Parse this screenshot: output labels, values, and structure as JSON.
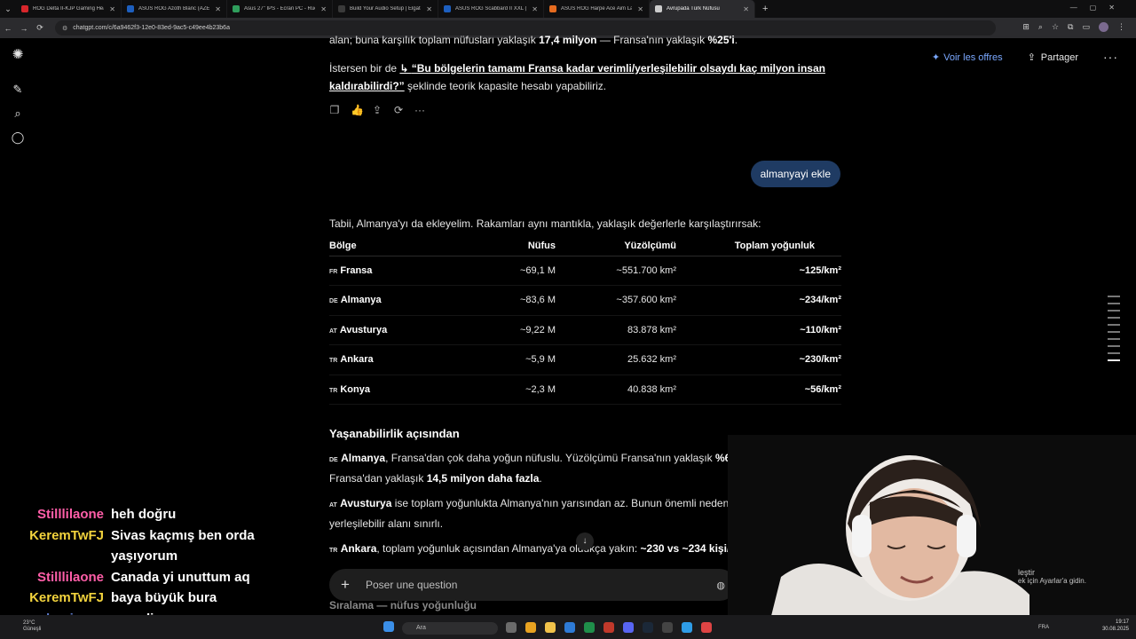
{
  "browser": {
    "tabs": [
      {
        "title": "ROG Delta II-KJP Gaming Headset",
        "color": "#d7262b"
      },
      {
        "title": "ASUS ROG Azoth Blanc (AZERTY)",
        "color": "#1d5fbf"
      },
      {
        "title": "Asus 27\" IPS - Ecran PC - Rue du Commerce",
        "color": "#2f9e5c"
      },
      {
        "title": "Build Your Audio Setup | Elgato",
        "color": "#3a3a3a"
      },
      {
        "title": "ASUS ROG Scabbard II XXL (Arm...",
        "color": "#1d5fbf"
      },
      {
        "title": "ASUS ROG Harpe Ace Aim Lab Edition",
        "color": "#e56b1f"
      },
      {
        "title": "Avrupada Türk Nüfusu",
        "color": "#cccccc"
      }
    ],
    "active_tab_index": 6,
    "url": "chatgpt.com/c/6a9462f3-12e0-83ed-9ac5-c49ee4b23b6a"
  },
  "header": {
    "offers_label": "Voir les offres",
    "share_label": "Partager"
  },
  "conversation": {
    "prev_line": "alan; buna karşılık toplam nüfusları yaklaşık 17,4 milyon — Fransa'nın yaklaşık %25'i.",
    "prev_line_parts": {
      "a": "alan; buna karşılık toplam nüfusları yaklaşık ",
      "b": "17,4 milyon",
      "c": " — Fransa'nın yaklaşık ",
      "d": "%25'i",
      "e": "."
    },
    "suggestion_prefix": "İstersen bir de ",
    "suggestion_arrow": "↳ ",
    "suggestion_link": "“Bu bölgelerin tamamı Fransa kadar verimli/yerleşilebilir olsaydı kaç milyon insan kaldırabilirdi?”",
    "suggestion_suffix": " şeklinde teorik kapasite hesabı yapabiliriz.",
    "user_message": "almanyayi ekle",
    "intro": "Tabii, Almanya'yı da ekleyelim. Rakamları aynı mantıkla, yaklaşık değerlerle karşılaştırırsak:",
    "table": {
      "headers": [
        "Bölge",
        "Nüfus",
        "Yüzölçümü",
        "Toplam yoğunluk"
      ],
      "rows": [
        {
          "flag": "FR",
          "name": "Fransa",
          "pop": "~69,1 M",
          "area": "~551.700 km²",
          "density": "~125/km²"
        },
        {
          "flag": "DE",
          "name": "Almanya",
          "pop": "~83,6 M",
          "area": "~357.600 km²",
          "density": "~234/km²"
        },
        {
          "flag": "AT",
          "name": "Avusturya",
          "pop": "~9,22 M",
          "area": "83.878 km²",
          "density": "~110/km²"
        },
        {
          "flag": "TR",
          "name": "Ankara",
          "pop": "~5,9 M",
          "area": "25.632 km²",
          "density": "~230/km²"
        },
        {
          "flag": "TR",
          "name": "Konya",
          "pop": "~2,3 M",
          "area": "40.838 km²",
          "density": "~56/km²"
        }
      ]
    },
    "section_title": "Yaşanabilirlik açısından",
    "para1": {
      "flag": "DE",
      "bold": "Almanya",
      "t1": ", Fransa'dan çok daha yoğun nüfuslu. Yüzölçümü Fransa'nın yaklaşık ",
      "b2": "%65'i",
      "t2": ", ama nüfusu Fransa'dan yaklaşık ",
      "b3": "14,5 milyon daha fazla",
      "t3": "."
    },
    "para2": {
      "flag": "AT",
      "bold": "Avusturya",
      "t1": " ise toplam yoğunlukta Almanya'nın yarısından az. Bunun önemli nedeni Alpler: ülkenin yerleşilebilir alanı sınırlı."
    },
    "para3": {
      "flag": "TR",
      "bold": "Ankara",
      "t1": ", toplam yoğunluk açısından Almanya'ya oldukça yakın: ",
      "b2": "~230 vs ~234 kişi/km²",
      "t2": "."
    },
    "trailing_text": "Sıralama — nüfus yoğunluğu"
  },
  "composer": {
    "placeholder": "Poser une question"
  },
  "stream_chat": [
    {
      "user": "Stilllilaone",
      "color": "#ff5ea8",
      "msg": "heh doğru"
    },
    {
      "user": "KeremTwFJ",
      "color": "#f2d33d",
      "msg": "Sivas kaçmış ben orda yaşıyorum"
    },
    {
      "user": "Stilllilaone",
      "color": "#ff5ea8",
      "msg": "Canada yi unuttum aq"
    },
    {
      "user": "KeremTwFJ",
      "color": "#f2d33d",
      "msg": "baya büyük bura"
    },
    {
      "user": "lumixeux",
      "color": "#5b79c9",
      "msg": "onemli"
    }
  ],
  "windows_toast": {
    "title": "leştir",
    "body": "ek için Ayarlar'a gidin."
  },
  "taskbar": {
    "weather_temp": "23°C",
    "weather_desc": "Güneşli",
    "search_placeholder": "Ara",
    "lang": "FRA",
    "time": "19:17",
    "date": "30.08.2025"
  }
}
